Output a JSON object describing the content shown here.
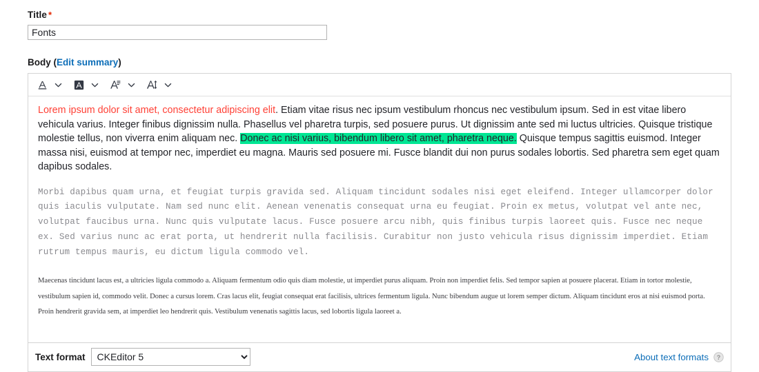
{
  "form": {
    "title_field": {
      "label": "Title",
      "required_mark": "*",
      "value": "Fonts",
      "placeholder": ""
    },
    "body_field": {
      "label": "Body",
      "paren_open": "(",
      "edit_summary_label": "Edit summary",
      "paren_close": ")"
    }
  },
  "toolbar": {
    "items": [
      {
        "icon": "font-color-icon",
        "label": "Font Color",
        "dropdown": "chevron-down-icon"
      },
      {
        "icon": "font-background-color-icon",
        "label": "Font Background Color",
        "dropdown": "chevron-down-icon"
      },
      {
        "icon": "font-family-icon",
        "label": "Font Family",
        "dropdown": "chevron-down-icon"
      },
      {
        "icon": "font-size-icon",
        "label": "Font Size",
        "dropdown": "chevron-down-icon"
      }
    ]
  },
  "body_content": {
    "paragraph_1": {
      "red_part": "Lorem ipsum dolor sit amet, consectetur adipiscing elit",
      "part_2": ". Etiam vitae risus nec ipsum vestibulum rhoncus nec vestibulum ipsum. Sed in est vitae libero vehicula varius. Integer finibus dignissim nulla. Phasellus vel pharetra turpis, sed posuere purus. Ut dignissim ante sed mi luctus ultricies. Quisque tristique molestie tellus, non viverra enim aliquam nec. ",
      "highlighted_part": "Donec ac nisi varius, bibendum libero sit amet, pharetra neque.",
      "part_4": " Quisque tempus sagittis euismod. Integer massa nisi, euismod at tempor nec, imperdiet eu magna. Mauris sed posuere mi. Fusce blandit dui non purus sodales lobortis. Sed pharetra sem eget quam dapibus sodales."
    },
    "paragraph_2": "Morbi dapibus quam urna, et feugiat turpis gravida sed. Aliquam tincidunt sodales nisi eget eleifend. Integer ullamcorper dolor quis iaculis vulputate. Nam sed nunc elit. Aenean venenatis consequat urna eu feugiat. Proin ex metus, volutpat vel ante nec, volutpat faucibus urna. Nunc quis vulputate lacus. Fusce posuere arcu nibh, quis finibus turpis laoreet quis. Fusce nec neque ex. Sed varius nunc ac erat porta, ut hendrerit nulla facilisis. Curabitur non justo vehicula risus dignissim imperdiet. Etiam rutrum tempus mauris, eu dictum ligula commodo vel.",
    "paragraph_3": "Maecenas tincidunt lacus est, a ultricies ligula commodo a. Aliquam fermentum odio quis diam molestie, ut imperdiet purus aliquam. Proin non imperdiet felis. Sed tempor sapien at posuere placerat. Etiam in tortor molestie, vestibulum sapien id, commodo velit. Donec a cursus lorem. Cras lacus elit, feugiat consequat erat facilisis, ultrices fermentum ligula. Nunc bibendum augue ut lorem semper dictum. Aliquam tincidunt eros at nisi euismod porta. Proin hendrerit gravida sem, at imperdiet leo hendrerit quis. Vestibulum venenatis sagittis lacus, sed lobortis ligula laoreet a."
  },
  "format_bar": {
    "label": "Text format",
    "selected_format": "CKEditor 5",
    "format_options": [
      "CKEditor 5"
    ],
    "about_label": "About text formats",
    "help_icon": "question-mark-help-icon"
  },
  "colors": {
    "link": "#0d6eb8",
    "required": "#e32700",
    "red_text": "#ff4136",
    "highlight_green": "#00e693",
    "border": "#d4d4d4",
    "mono_text": "#8a8a8f"
  }
}
